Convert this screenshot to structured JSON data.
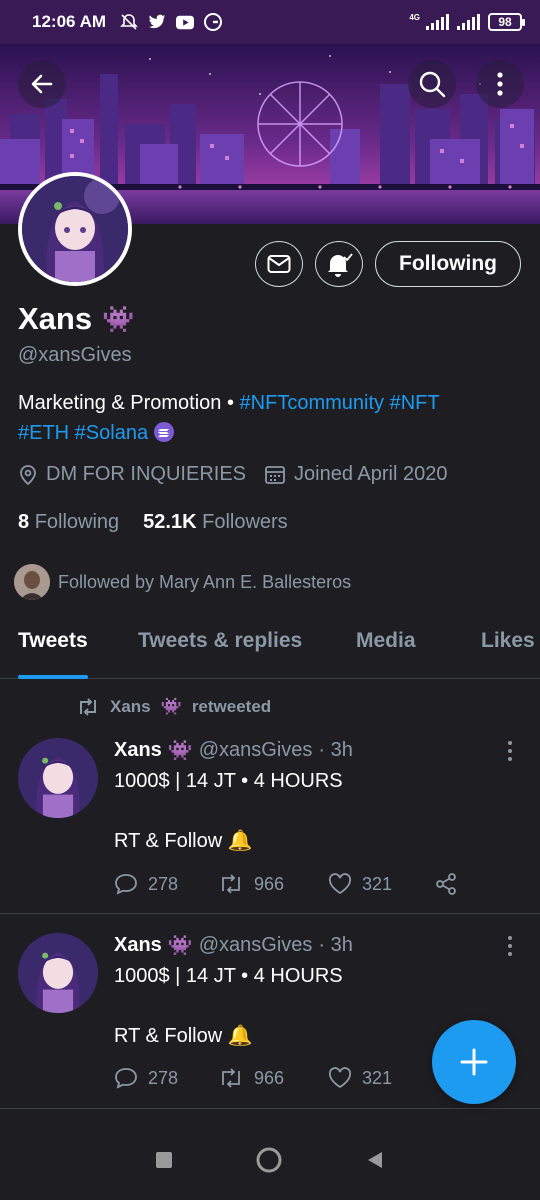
{
  "status_bar": {
    "time": "12:06 AM",
    "network": "4G",
    "battery": "98"
  },
  "profile": {
    "name": "Xans",
    "name_emoji": "👾",
    "handle": "@xansGives",
    "bio_prefix": "Marketing & Promotion • ",
    "bio_tags_line1": "#NFTcommunity #NFT",
    "bio_tags_line2": "#ETH #Solana",
    "location": "DM FOR INQUIERIES",
    "joined": "Joined April 2020",
    "following_count": "8",
    "following_label": "Following",
    "followers_count": "52.1K",
    "followers_label": "Followers",
    "followed_by": "Followed by Mary Ann E. Ballesteros",
    "follow_button": "Following"
  },
  "tabs": [
    {
      "label": "Tweets",
      "active": true
    },
    {
      "label": "Tweets & replies",
      "active": false
    },
    {
      "label": "Media",
      "active": false
    },
    {
      "label": "Likes",
      "active": false
    }
  ],
  "retweet_label": {
    "name": "Xans",
    "emoji": "👾",
    "suffix": "retweeted"
  },
  "tweets": [
    {
      "name": "Xans",
      "emoji": "👾",
      "handle": "@xansGives",
      "time": "· 3h",
      "line1": "1000$ | 14 JT • 4 HOURS",
      "line2": "RT & Follow 🔔",
      "replies": "278",
      "retweets": "966",
      "likes": "321"
    },
    {
      "name": "Xans",
      "emoji": "👾",
      "handle": "@xansGives",
      "time": "· 3h",
      "line1": "1000$ | 14 JT • 4 HOURS",
      "line2": "RT & Follow 🔔",
      "replies": "278",
      "retweets": "966",
      "likes": "321"
    }
  ],
  "colors": {
    "accent": "#1d9bf0",
    "background": "#1e1e22",
    "muted": "#8b98a5"
  }
}
